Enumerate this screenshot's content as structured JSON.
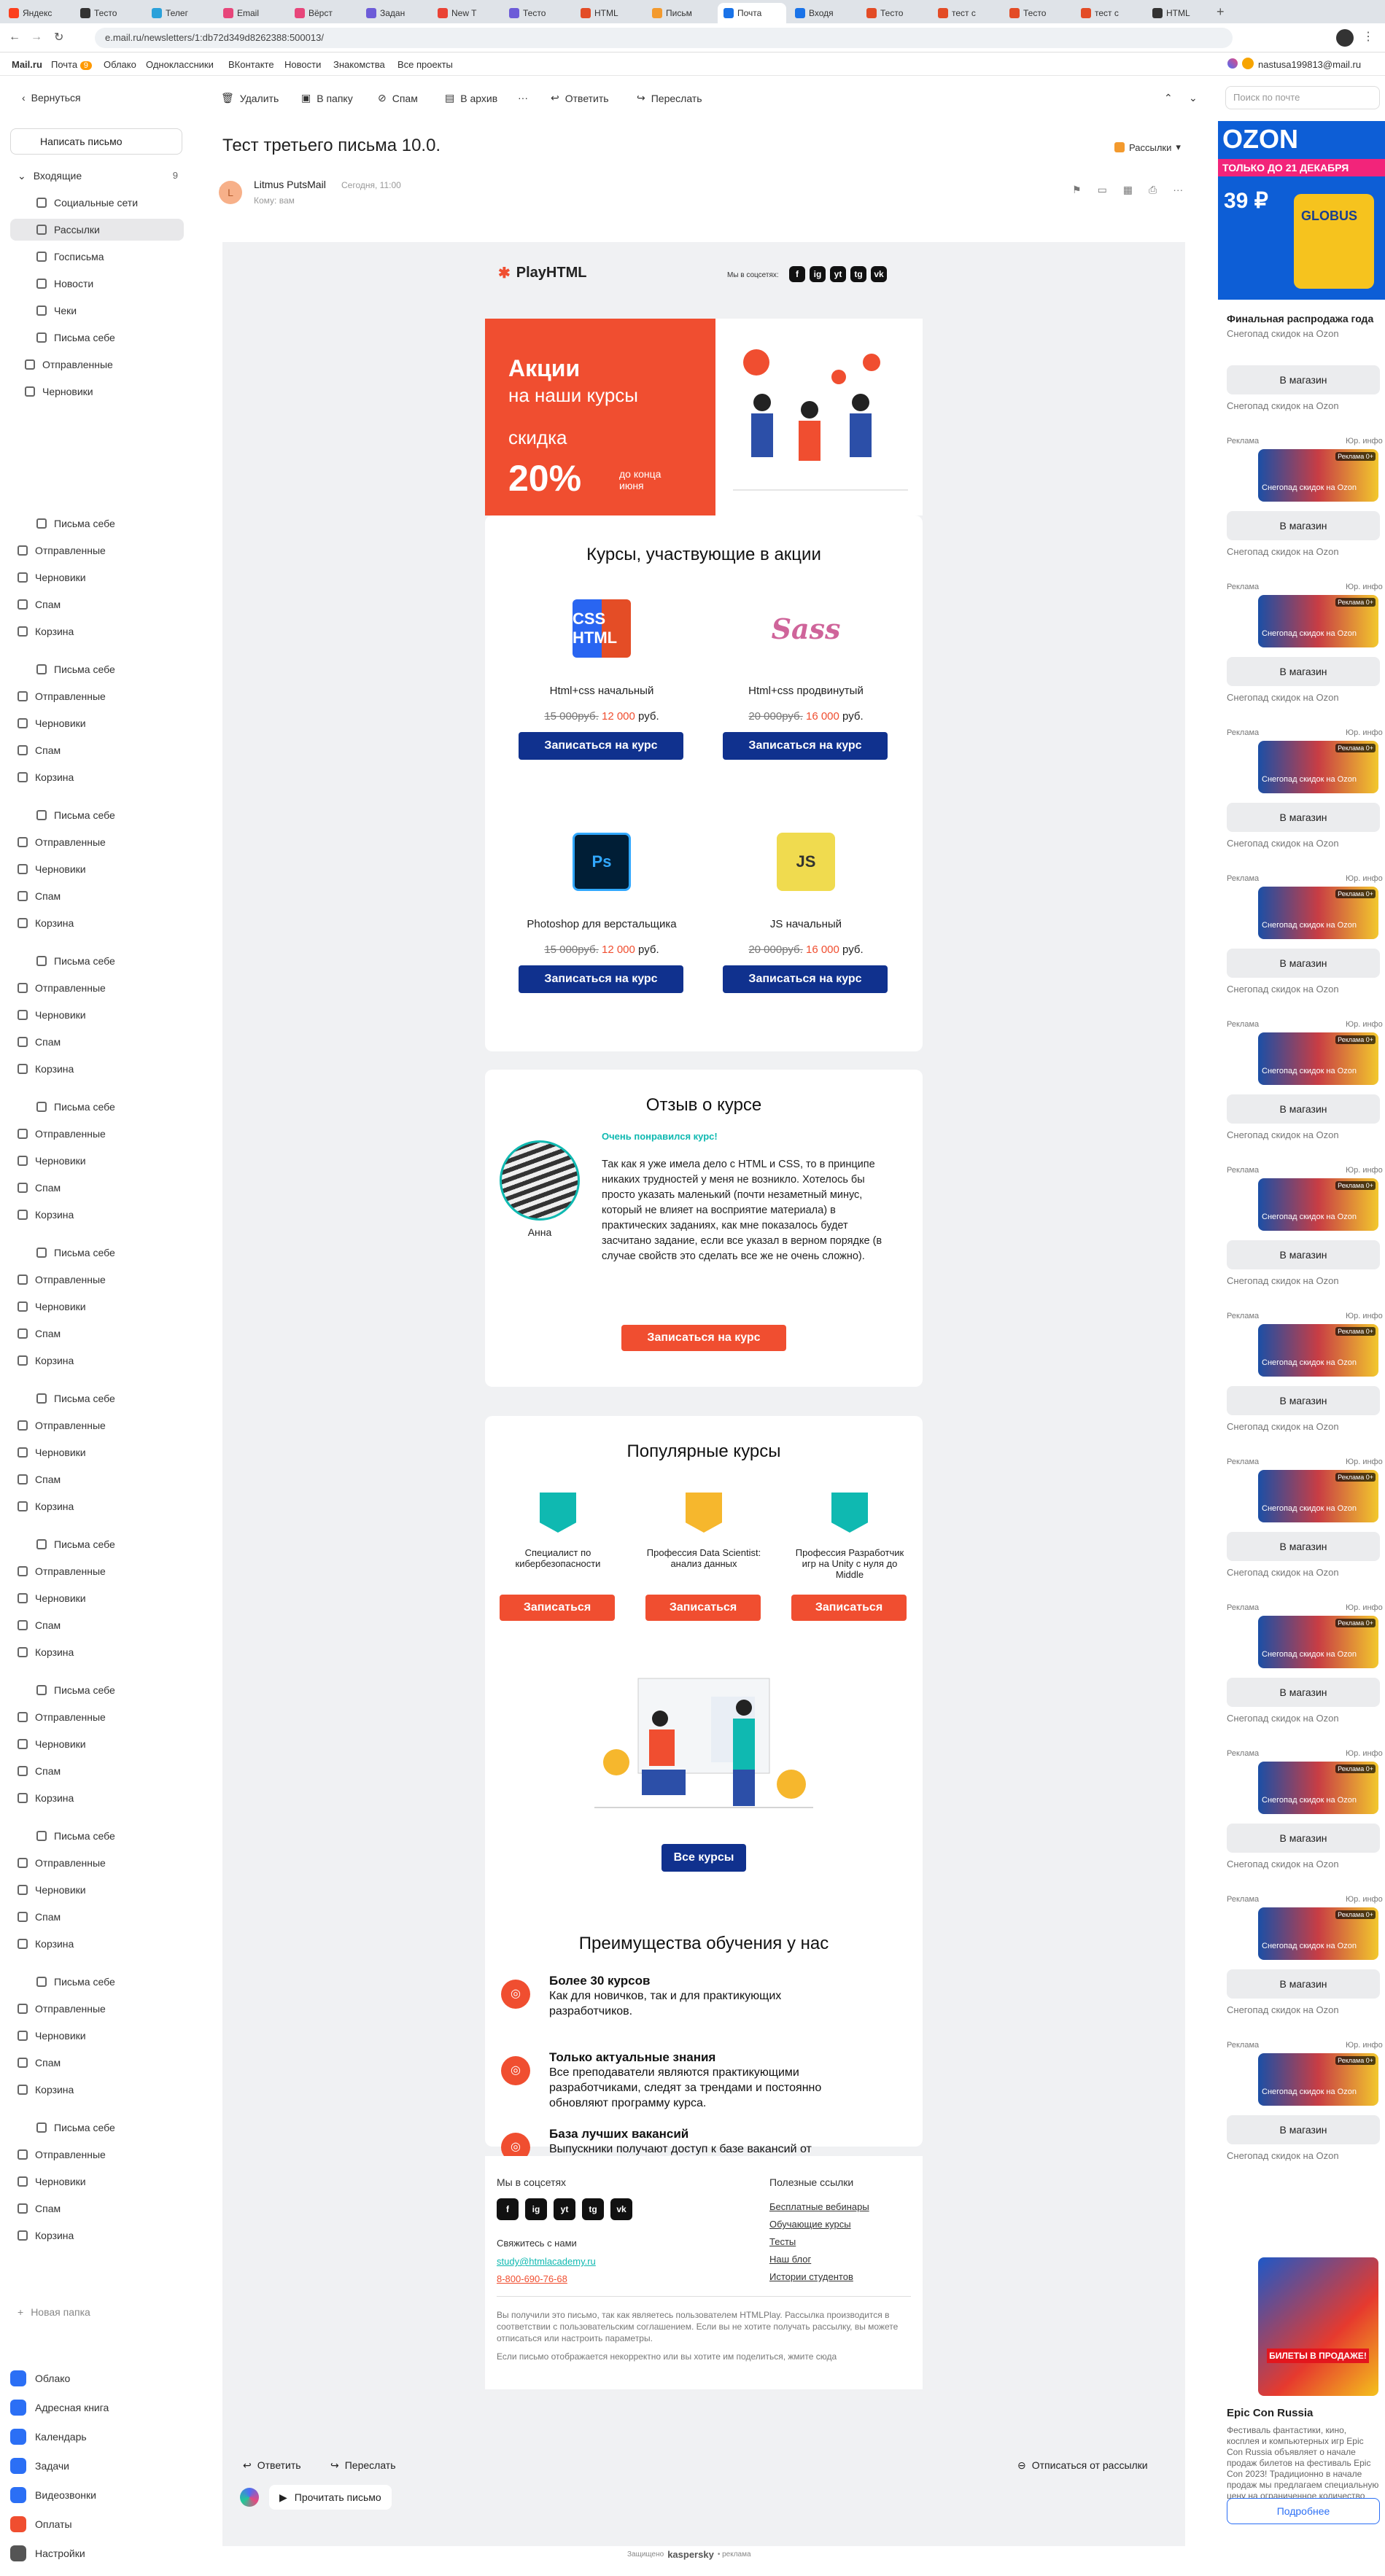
{
  "browser": {
    "tabs": [
      "Яндекс",
      "Тесто",
      "Телег",
      "Email",
      "Вёрст",
      "Задан",
      "New T",
      "Тесто",
      "HTML",
      "Письм",
      "Почта",
      "Входя",
      "Тесто",
      "тест с",
      "Тесто",
      "тест с",
      "HTML"
    ],
    "url": "e.mail.ru/newsletters/1:db72d349d8262388:500013/",
    "account": "nastusa199813@mail.ru"
  },
  "portal": {
    "logo": "Mail.ru",
    "mail": "Почта",
    "mail_badge": "9",
    "links": [
      "Облако",
      "Одноклассники",
      "ВКонтакте",
      "Новости",
      "Знакомства",
      "Все проекты"
    ]
  },
  "toolbar": {
    "back": "Вернуться",
    "delete": "Удалить",
    "to_folder": "В папку",
    "spam": "Спам",
    "archive": "В архив",
    "reply": "Ответить",
    "forward": "Переслать",
    "search_placeholder": "Поиск по почте"
  },
  "sidebar": {
    "compose": "Написать письмо",
    "inbox": "Входящие",
    "inbox_count": "9",
    "top_folders": [
      "Социальные сети",
      "Рассылки",
      "Госписьма",
      "Новости",
      "Чеки",
      "Письма себе",
      "Отправленные",
      "Черновики"
    ],
    "repeat_folders": [
      "Письма себе",
      "Отправленные",
      "Черновики",
      "Спам",
      "Корзина"
    ],
    "new_folder": "Новая папка",
    "services": [
      "Облако",
      "Адресная книга",
      "Календарь",
      "Задачи",
      "Видеозвонки",
      "Оплаты",
      "Настройки"
    ]
  },
  "letter": {
    "subject": "Тест третьего письма 10.0.",
    "category": "Рассылки",
    "sender": "Litmus PutsMail",
    "date": "Сегодня, 11:00",
    "to": "Кому: вам",
    "avatar_letter": "L"
  },
  "email": {
    "logo": "PlayHTML",
    "social_label": "Мы в соцсетях:",
    "social_icons": [
      "f",
      "ig",
      "yt",
      "tg",
      "vk"
    ],
    "hero": {
      "line1": "Акции",
      "line2": "на наши курсы",
      "line3": "скидка",
      "discount": "20%",
      "until": "до конца июня"
    },
    "courses_title": "Курсы, участвующие в акции",
    "courses": [
      {
        "name": "Html+css начальный",
        "old": "15 000руб.",
        "new": "12 000",
        "cur": "руб.",
        "btn": "Записаться на курс",
        "badge": "CSS HTML"
      },
      {
        "name": "Html+css продвинутый",
        "old": "20 000руб.",
        "new": "16 000",
        "cur": "руб.",
        "btn": "Записаться на курс",
        "badge": "Sass"
      },
      {
        "name": "Photoshop для верстальщика",
        "old": "15 000руб.",
        "new": "12 000",
        "cur": "руб.",
        "btn": "Записаться на курс",
        "badge": "Ps"
      },
      {
        "name": "JS начальный",
        "old": "20 000руб.",
        "new": "16 000",
        "cur": "руб.",
        "btn": "Записаться на курс",
        "badge": "JS"
      }
    ],
    "review": {
      "title": "Отзыв о курсе",
      "headline": "Очень понравился курс!",
      "text": "Так как я уже имела дело с HTML и CSS, то в принципе никаких трудностей у меня не возникло. Хотелось бы просто указать маленький (почти незаметный минус, который не влияет на восприятие материала) в практических заданиях, как мне показалось будет засчитано задание, если все указал в верном порядке (в случае свойств это сделать все же не очень сложно).",
      "author": "Анна",
      "btn": "Записаться на курс"
    },
    "popular": {
      "title": "Популярные курсы",
      "items": [
        {
          "name": "Специалист по кибербезопасности",
          "btn": "Записаться"
        },
        {
          "name": "Профессия Data Scientist: анализ данных",
          "btn": "Записаться"
        },
        {
          "name": "Профессия Разработчик игр на Unity с нуля до Middle",
          "btn": "Записаться"
        }
      ],
      "all_btn": "Все курсы"
    },
    "advantages": {
      "title": "Преимущества обучения у нас",
      "items": [
        {
          "title": "Более 30 курсов",
          "text": "Как для новичков, так и для практикующих разработчиков."
        },
        {
          "title": "Только актуальные знания",
          "text": "Все преподаватели являются практикующими разработчиками, следят за трендами и постоянно обновляют программу курса."
        },
        {
          "title": "База лучших вакансий",
          "text": "Выпускники получают доступ к базе вакансий от ведущих работодателей."
        }
      ]
    },
    "footer": {
      "social_title": "Мы в соцсетях",
      "contact_label": "Свяжитесь с нами",
      "email": "study@htmlacademy.ru",
      "phone": "8-800-690-76-68",
      "links_title": "Полезные ссылки",
      "links": [
        "Бесплатные вебинары",
        "Обучающие курсы",
        "Тесты",
        "Наш блог",
        "Истории студентов"
      ],
      "legal": "Вы получили это письмо, так как являетесь пользователем HTMLPlay. Рассылка производится в соответствии с пользовательским соглашением. Если вы не хотите получать рассылку, вы можете отписаться или настроить параметры.",
      "legal2": "Если письмо отображается некорректно или вы хотите им поделиться, жмите сюда"
    }
  },
  "bottom": {
    "reply": "Ответить",
    "forward": "Переслать",
    "unsubscribe": "Отписаться от рассылки",
    "read_aloud": "Прочитать письмо",
    "protected": "Защищено",
    "kaspersky": "kaspersky",
    "protected_tail": "• реклама"
  },
  "ads": {
    "ozon_logo": "OZON",
    "ozon_banner": "ТОЛЬКО ДО 21 ДЕКАБРЯ",
    "ozon_price": "39 ₽",
    "ozon_brand": "GLOBUS",
    "title": "Финальная распродажа года",
    "subtitle": "Снегопад скидок на Ozon",
    "btn": "В магазин",
    "ad_label": "Реклама",
    "ad_info": "Юр. инфо",
    "age_badge": "Реклама 0+",
    "epic_title": "Epic Con Russia",
    "epic_banner": "БИЛЕТЫ В ПРОДАЖЕ!",
    "epic_text": "Фестиваль фантастики, кино, косплея и компьютерных игр Epic Con Russia объявляет о начале продаж билетов на фестиваль Epic Con 2023! Традиционно в начале продаж мы предлагаем специальную цену на ограниченное количество",
    "more_btn": "Подробнее"
  }
}
